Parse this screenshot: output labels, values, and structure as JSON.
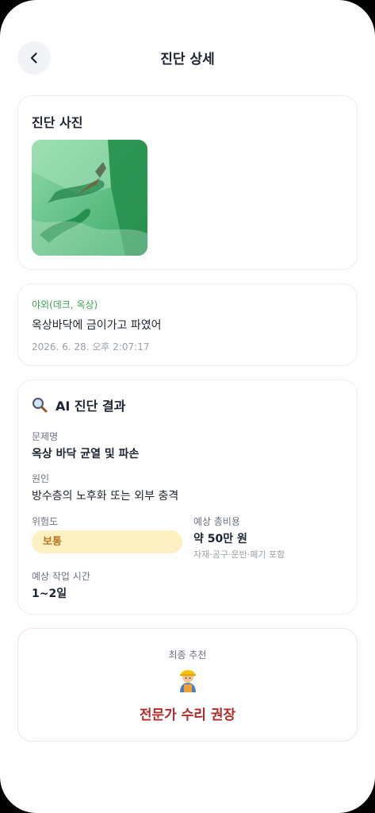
{
  "header": {
    "title": "진단 상세",
    "back_icon": "chevron-left-icon"
  },
  "photo_card": {
    "title": "진단 사진"
  },
  "entry": {
    "category": "야외(데크, 옥상)",
    "description": "옥상바닥에 금이가고 파였어",
    "timestamp": "2026. 6. 28. 오후 2:07:17"
  },
  "result": {
    "title": "AI 진단 결과",
    "icon": "magnifier-icon",
    "problem_label": "문제명",
    "problem_value": "옥상 바닥 균열 및 파손",
    "cause_label": "원인",
    "cause_value": "방수층의 노후화 또는 외부 충격",
    "risk_label": "위험도",
    "risk_value": "보통",
    "cost_label": "예상 총비용",
    "cost_value": "약 50만 원",
    "cost_note": "자재·공구·운반·폐기 포함",
    "time_label": "예상 작업 시간",
    "time_value": "1~2일"
  },
  "final": {
    "label": "최종 추천",
    "icon": "construction-worker-icon",
    "recommendation": "전문가 수리 권장"
  },
  "colors": {
    "category_green": "#37a24f",
    "risk_badge_bg": "#fdf1c4",
    "risk_badge_text": "#b7791f",
    "recommendation_red": "#b42a2a"
  }
}
